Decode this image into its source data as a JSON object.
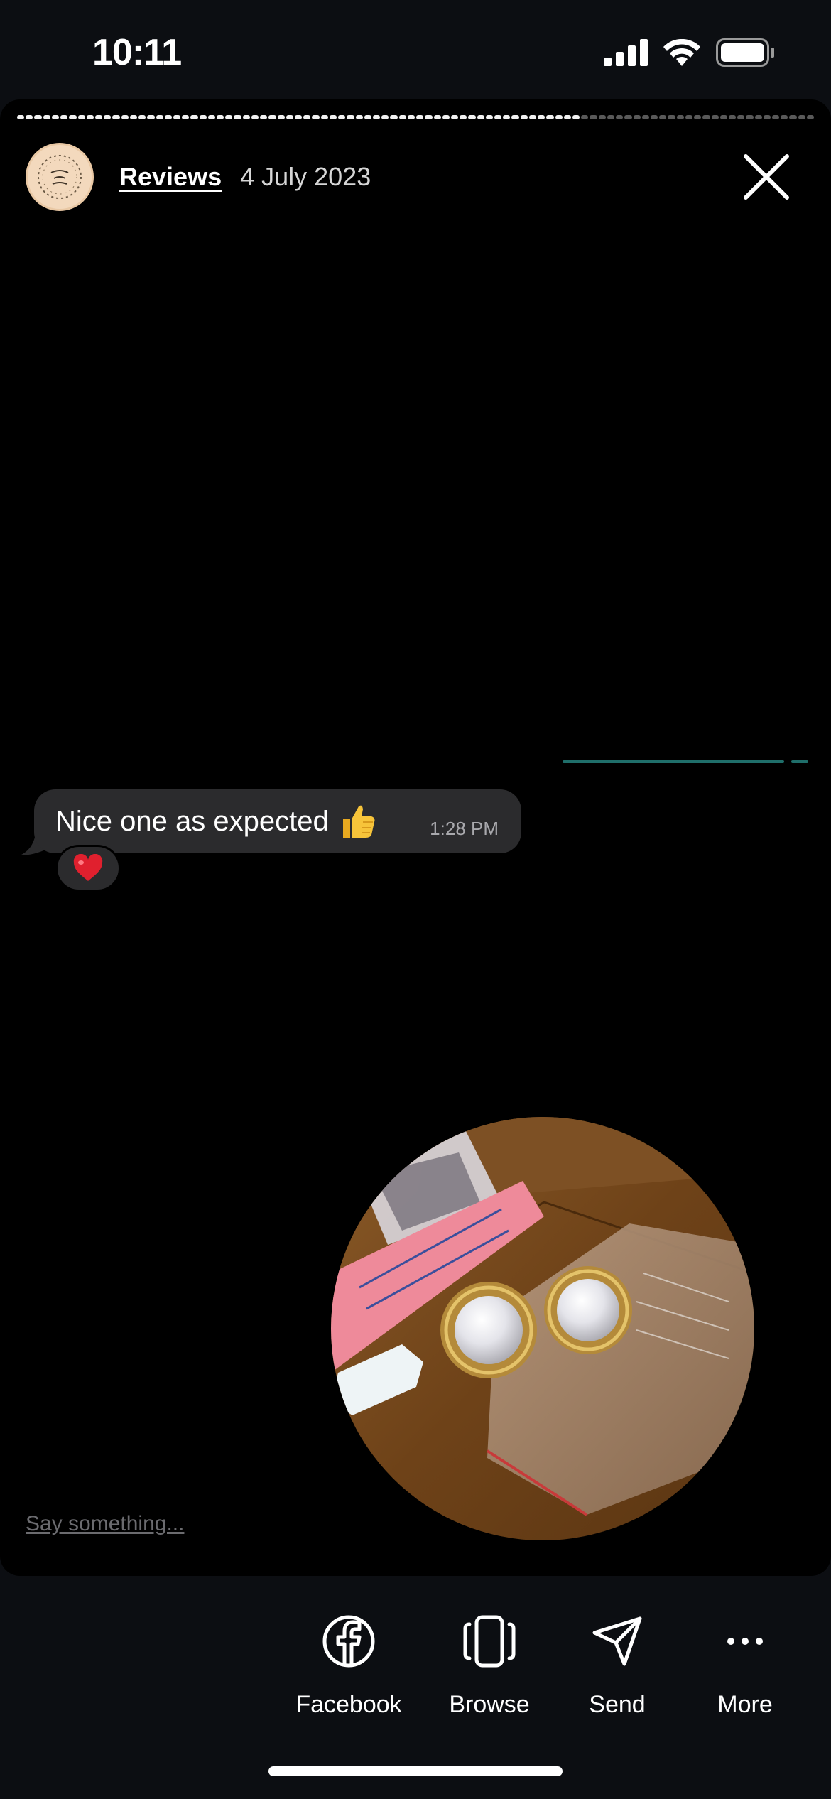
{
  "status_bar": {
    "time": "10:11"
  },
  "story": {
    "progress": {
      "segments": 92,
      "completed": 65
    },
    "header": {
      "account_label": "Reviews",
      "date": "4 July 2023"
    },
    "message": {
      "text": "Nice one as expected",
      "emoji": "thumbs-up",
      "time": "1:28 PM",
      "reaction": "red-heart"
    },
    "reply_placeholder": "Say something..."
  },
  "share": {
    "facebook_label": "Facebook",
    "browse_label": "Browse",
    "send_label": "Send",
    "more_label": "More"
  },
  "colors": {
    "background": "#0c0e12",
    "story_background": "#000000",
    "bubble": "#2b2b2d",
    "accent_line": "#1f6e6a"
  }
}
